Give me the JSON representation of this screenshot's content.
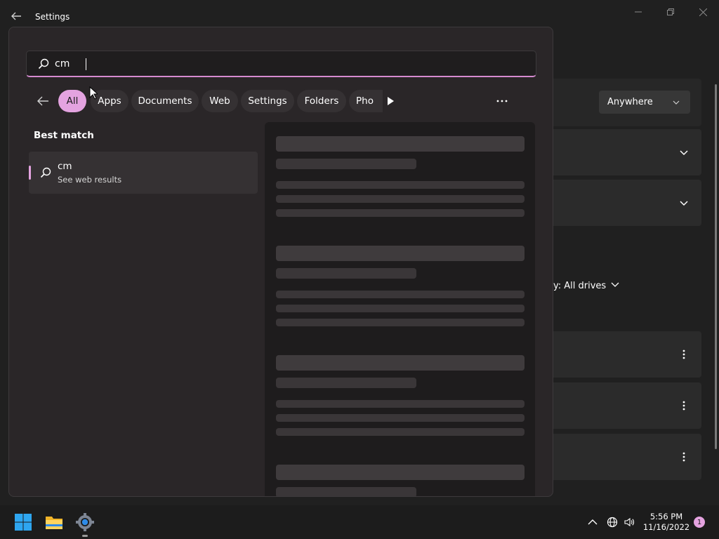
{
  "window": {
    "title": "Settings"
  },
  "search": {
    "value": "cm",
    "placeholder": ""
  },
  "filters": {
    "chips": [
      "All",
      "Apps",
      "Documents",
      "Web",
      "Settings",
      "Folders",
      "Pho"
    ],
    "active": "All"
  },
  "results": {
    "heading": "Best match",
    "best_match": {
      "title": "cm",
      "subtitle": "See web results"
    }
  },
  "background": {
    "scope_dropdown": "Anywhere",
    "drives_filter": "y: All drives"
  },
  "taskbar": {
    "time": "5:56 PM",
    "date": "11/16/2022",
    "notification_count": "1"
  },
  "colors": {
    "accent": "#e4a3e0",
    "flyout_bg": "#2a2628",
    "page_bg": "#202020"
  }
}
